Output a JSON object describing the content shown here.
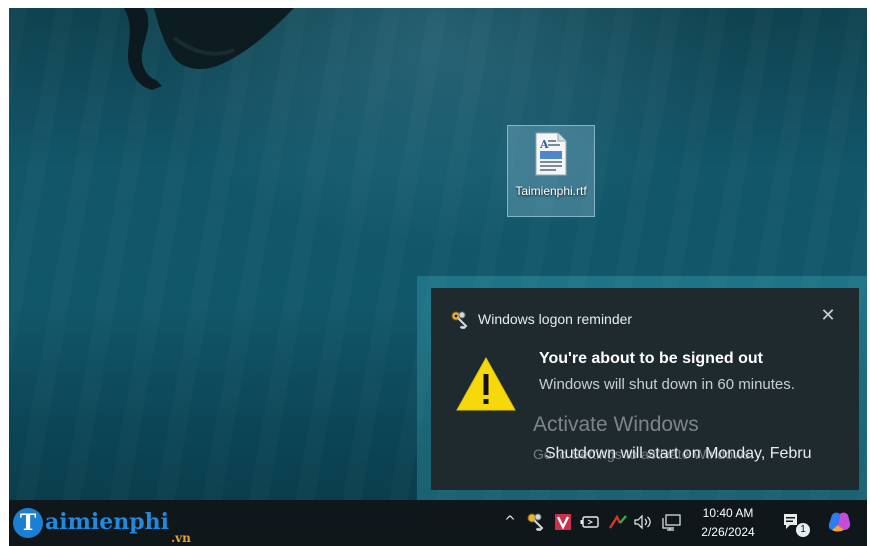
{
  "desktop": {
    "file_icon_label": "Taimienphi.rtf"
  },
  "toast": {
    "app_name": "Windows logon reminder",
    "close_glyph": "✕",
    "title": "You're about to be signed out",
    "body": "Windows will shut down in 60 minutes.",
    "footer": "Shutdown will start on Monday, Febru",
    "warning_color": "#f7d80b"
  },
  "watermark": {
    "title": "Activate Windows",
    "subtitle": "Go to Settings to activate Windows."
  },
  "taskbar": {
    "brand_initial": "T",
    "brand_name": "aimienphi",
    "brand_tld": ".vn",
    "tray": {
      "chevron": "^",
      "notification_count": "1"
    },
    "clock": {
      "time": "10:40 AM",
      "date": "2/26/2024"
    }
  },
  "colors": {
    "toast_background": "#1f2a2e",
    "taskbar_background": "#10171a",
    "brand_blue": "#1f8ae0",
    "v_app_red": "#c8324b"
  },
  "icons": [
    "file-rtf-icon",
    "keys-icon",
    "warning-icon",
    "close-icon",
    "chevron-up-icon",
    "v-app-icon",
    "battery-icon",
    "network-activity-icon",
    "speaker-icon",
    "display-icon",
    "notification-center-icon",
    "copilot-icon"
  ]
}
